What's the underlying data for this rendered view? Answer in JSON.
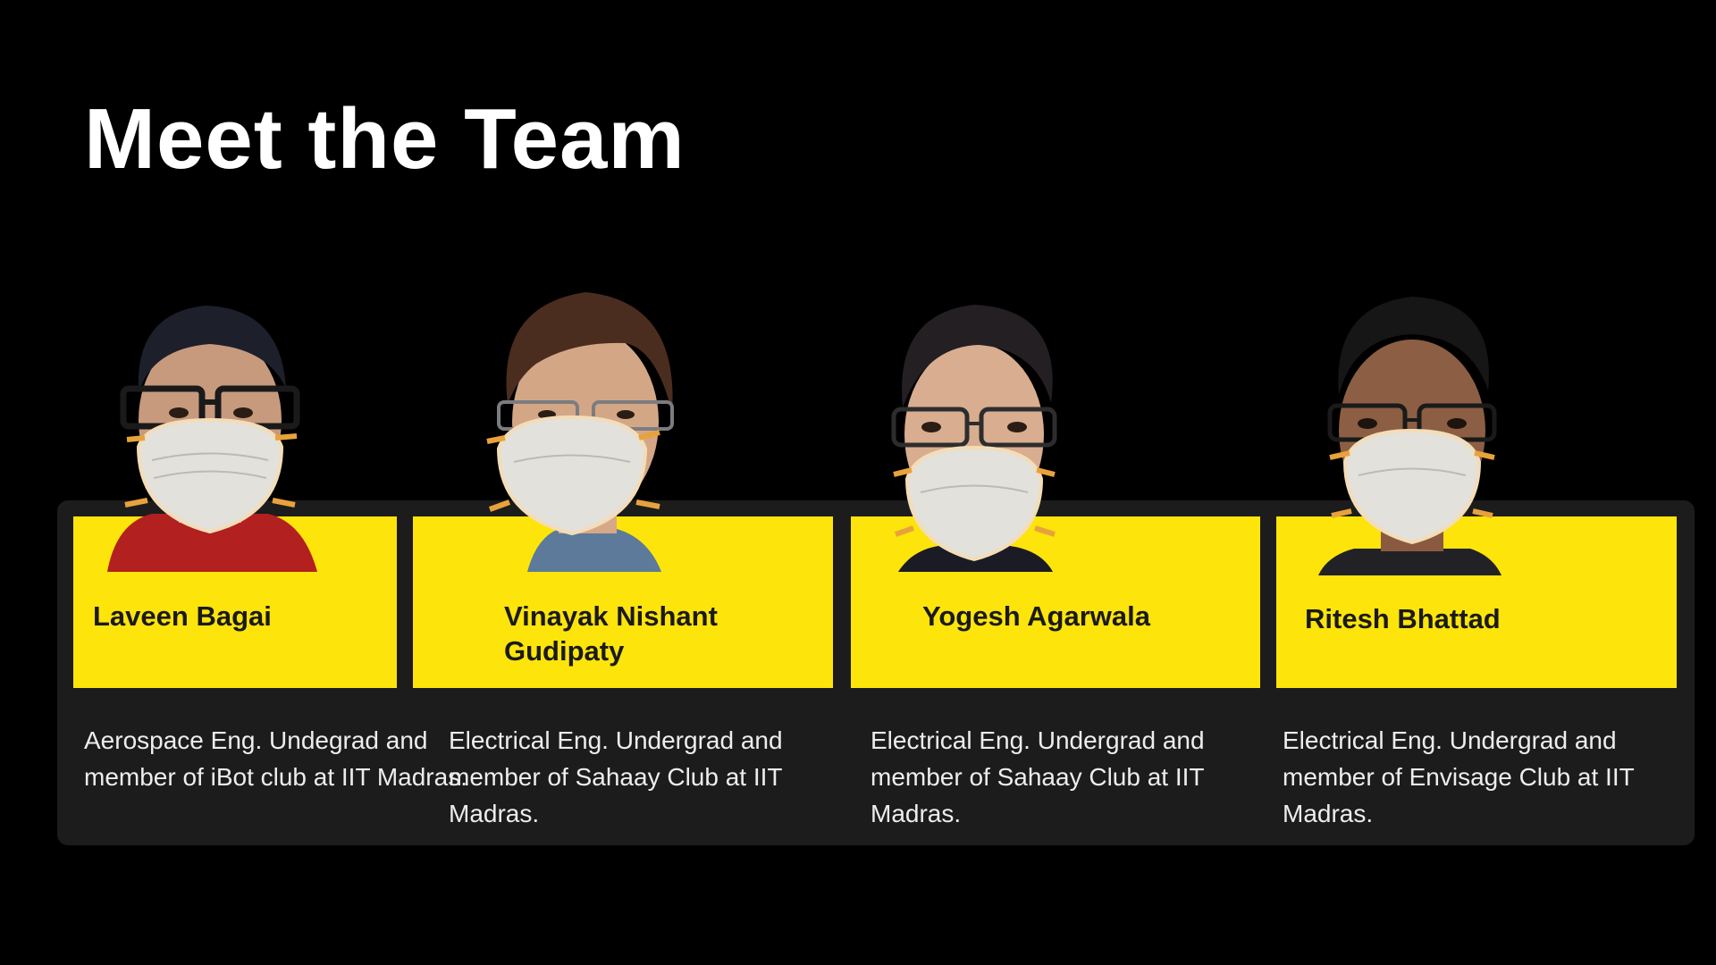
{
  "title": "Meet the Team",
  "colors": {
    "background": "#000000",
    "card": "#fde40b",
    "panel": "#1c1c1c",
    "text": "#ededed",
    "name": "#1a1a1a"
  },
  "members": [
    {
      "name": "Laveen Bagai",
      "description": "Aerospace Eng. Undegrad and member of iBot club at IIT Madras."
    },
    {
      "name": "Vinayak Nishant Gudipaty",
      "description": "Electrical  Eng. Undergrad and member of Sahaay Club  at IIT Madras."
    },
    {
      "name": "Yogesh Agarwala",
      "description": "Electrical Eng. Undergrad and member of Sahaay Club at IIT Madras."
    },
    {
      "name": "Ritesh Bhattad",
      "description": "Electrical Eng. Undergrad and member of Envisage Club at IIT Madras."
    }
  ]
}
